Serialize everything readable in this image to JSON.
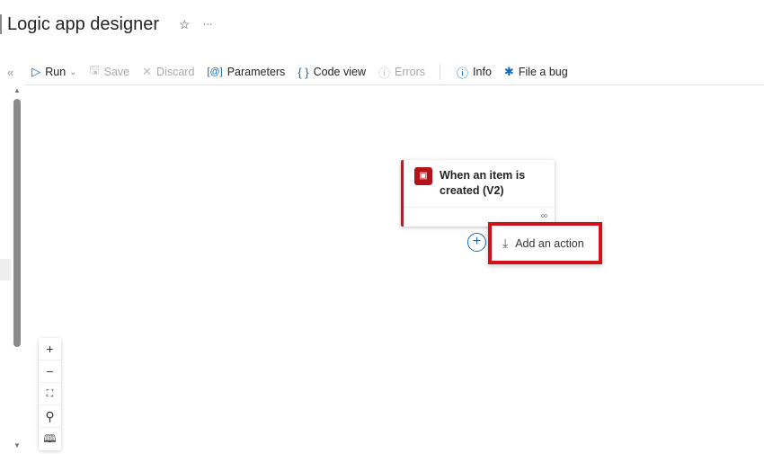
{
  "header": {
    "title": "Logic app designer",
    "favorite_icon": "☆",
    "more_icon": "···"
  },
  "toolbar": {
    "collapse_icon": "«",
    "items": [
      {
        "label": "Run",
        "icon": "▷",
        "chevron": "⌄",
        "disabled": false
      },
      {
        "label": "Save",
        "icon": "🖫",
        "disabled": true
      },
      {
        "label": "Discard",
        "icon": "✕",
        "disabled": true
      },
      {
        "label": "Parameters",
        "icon": "[@]",
        "disabled": false
      },
      {
        "label": "Code view",
        "icon": "{ }",
        "disabled": false
      },
      {
        "label": "Errors",
        "icon": "ⓘ",
        "disabled": true
      },
      {
        "label": "Info",
        "icon": "ⓘ",
        "disabled": false
      },
      {
        "label": "File a bug",
        "icon": "✱",
        "disabled": false
      }
    ]
  },
  "canvas": {
    "trigger": {
      "title": "When an item is created (V2)",
      "color": "#a4262c"
    },
    "add_action": {
      "label": "Add an action",
      "icon": "⤓",
      "plus": "+"
    },
    "zoom_controls": [
      "+",
      "−",
      "⛶",
      "⚲",
      "🕮"
    ]
  }
}
